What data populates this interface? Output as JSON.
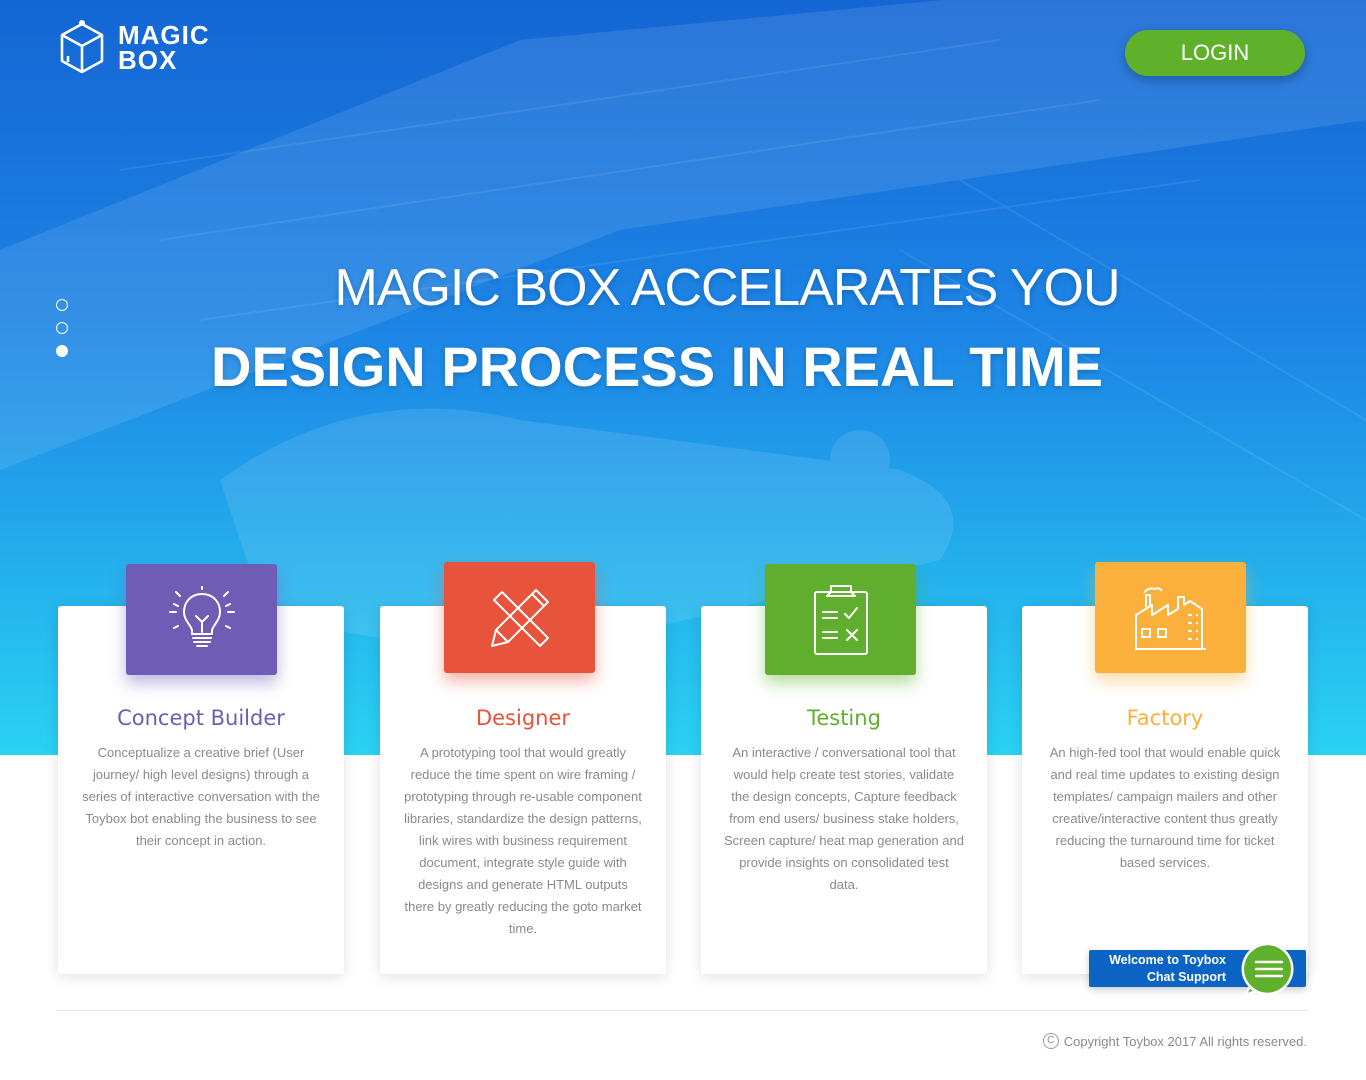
{
  "brand": {
    "line1": "MAGIC",
    "line2": "BOX"
  },
  "header": {
    "login_label": "LOGIN"
  },
  "hero": {
    "line1": "MAGIC BOX ACCELARATES YOU",
    "line2": "DESIGN PROCESS IN REAL TIME",
    "slides": 3,
    "active_slide": 3
  },
  "cards": [
    {
      "title": "Concept Builder",
      "desc": "Conceptualize a creative brief (User journey/ high level designs) through a series of interactive conversation with the Toybox bot enabling the business to see their concept in action.",
      "color": "#6f5cb5",
      "icon": "lightbulb-icon"
    },
    {
      "title": "Designer",
      "desc": "A prototyping tool that would greatly reduce the time spent on wire framing / prototyping through re-usable component libraries, standardize the design patterns, link wires with business requirement document, integrate style guide with designs and generate HTML outputs there by greatly reducing the goto market time.",
      "color": "#e8533b",
      "icon": "pencil-ruler-icon"
    },
    {
      "title": "Testing",
      "desc": "An interactive / conversational tool that would help create test stories, validate the design concepts, Capture feedback from end users/ business stake holders, Screen capture/ heat map generation and provide insights on consolidated test data.",
      "color": "#5fae2e",
      "icon": "clipboard-check-icon"
    },
    {
      "title": "Factory",
      "desc": "An high-fed tool that would enable quick and real time updates to existing design templates/ campaign mailers and other creative/interactive content thus greatly reducing the turnaround time for ticket based services.",
      "color": "#fbb03b",
      "icon": "factory-icon"
    }
  ],
  "footer": {
    "copyright": "Copyright Toybox 2017 All rights reserved.",
    "copyright_symbol": "C"
  },
  "chat": {
    "line1": "Welcome to Toybox",
    "line2": "Chat Support",
    "color": "#0b64c4",
    "bubble_color": "#5fb12c"
  }
}
